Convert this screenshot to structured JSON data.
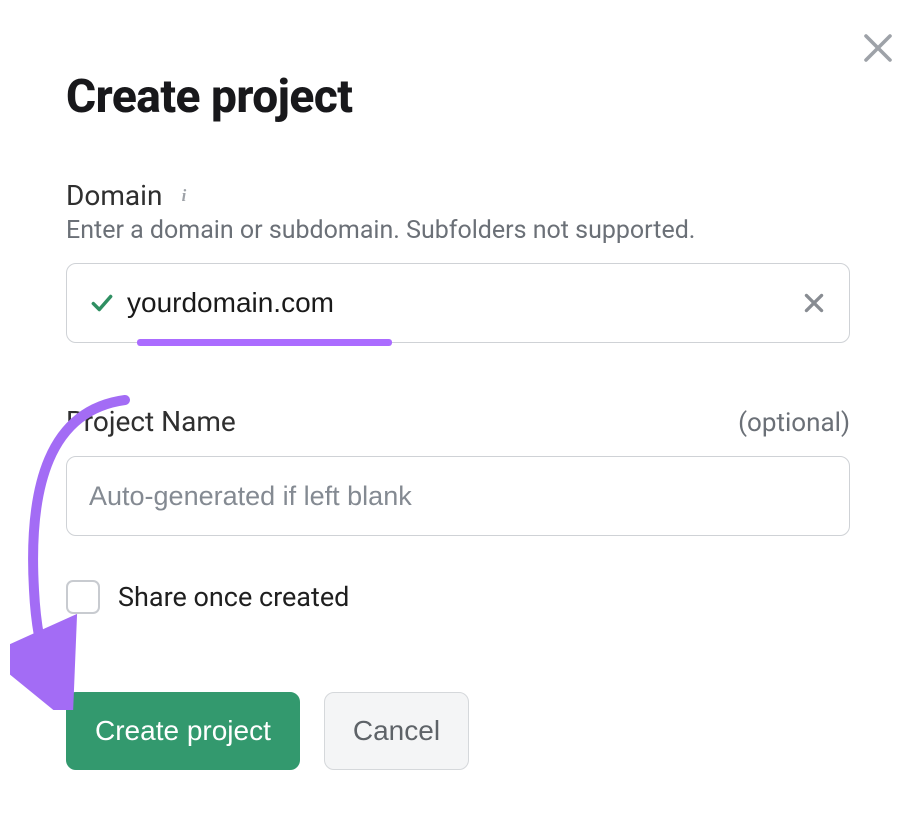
{
  "modal": {
    "title": "Create project",
    "close_label": "Close"
  },
  "domain": {
    "label": "Domain",
    "helper": "Enter a domain or subdomain. Subfolders not supported.",
    "value": "yourdomain.com",
    "clear_label": "Clear"
  },
  "project_name": {
    "label": "Project Name",
    "optional": "(optional)",
    "value": "",
    "placeholder": "Auto-generated if left blank"
  },
  "share": {
    "label": "Share once created",
    "checked": false
  },
  "buttons": {
    "create": "Create project",
    "cancel": "Cancel"
  },
  "colors": {
    "primary": "#33996e",
    "highlight": "#ab6cff",
    "text_muted": "#6b7077"
  }
}
